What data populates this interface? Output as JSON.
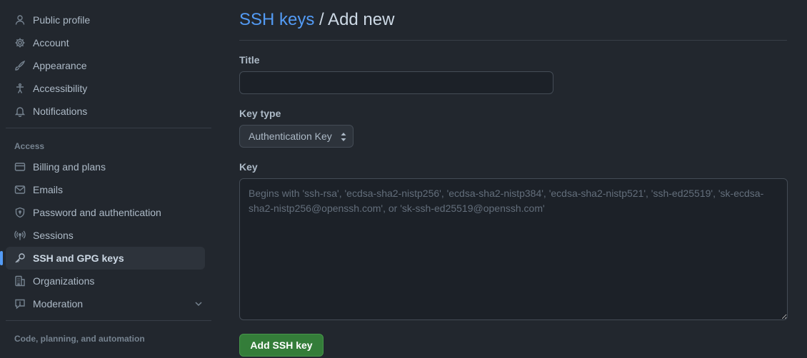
{
  "sidebar": {
    "top_items": [
      {
        "label": "Public profile",
        "icon": "person-icon"
      },
      {
        "label": "Account",
        "icon": "gear-icon"
      },
      {
        "label": "Appearance",
        "icon": "paintbrush-icon"
      },
      {
        "label": "Accessibility",
        "icon": "accessibility-icon"
      },
      {
        "label": "Notifications",
        "icon": "bell-icon"
      }
    ],
    "access_heading": "Access",
    "access_items": [
      {
        "label": "Billing and plans",
        "icon": "credit-card-icon"
      },
      {
        "label": "Emails",
        "icon": "mail-icon"
      },
      {
        "label": "Password and authentication",
        "icon": "shield-lock-icon"
      },
      {
        "label": "Sessions",
        "icon": "broadcast-icon"
      },
      {
        "label": "SSH and GPG keys",
        "icon": "key-icon",
        "active": true
      },
      {
        "label": "Organizations",
        "icon": "organization-icon"
      },
      {
        "label": "Moderation",
        "icon": "report-icon",
        "expandable": true
      }
    ],
    "code_heading": "Code, planning, and automation"
  },
  "main": {
    "breadcrumb_link": "SSH keys",
    "breadcrumb_rest": " / Add new",
    "title_label": "Title",
    "title_value": "",
    "key_type_label": "Key type",
    "key_type_value": "Authentication Key",
    "key_label": "Key",
    "key_placeholder": "Begins with 'ssh-rsa', 'ecdsa-sha2-nistp256', 'ecdsa-sha2-nistp384', 'ecdsa-sha2-nistp521', 'ssh-ed25519', 'sk-ecdsa-sha2-nistp256@openssh.com', or 'sk-ssh-ed25519@openssh.com'",
    "submit_label": "Add SSH key"
  },
  "colors": {
    "background": "#22272e",
    "link": "#539bf5",
    "primary_button": "#347d39",
    "active_indicator": "#539bf5"
  }
}
